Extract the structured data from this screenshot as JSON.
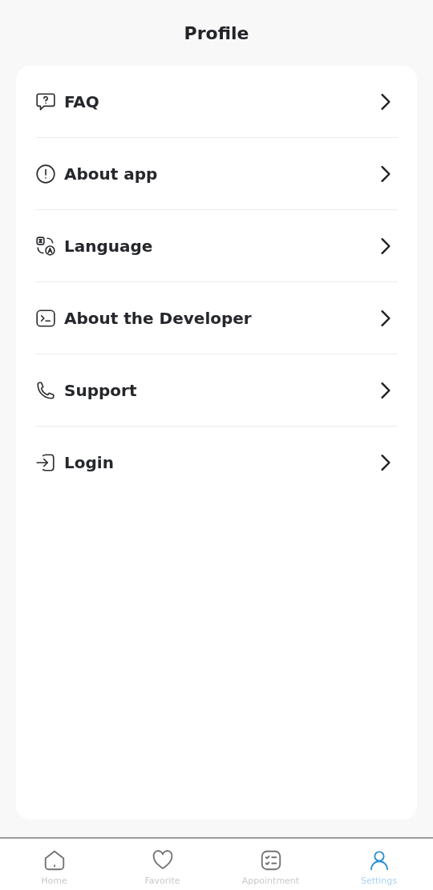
{
  "header": {
    "title": "Profile"
  },
  "menu": [
    {
      "label": "FAQ"
    },
    {
      "label": "About app"
    },
    {
      "label": "Language"
    },
    {
      "label": "About the Developer"
    },
    {
      "label": "Support"
    },
    {
      "label": "Login"
    }
  ],
  "bottom_nav": [
    {
      "label": "Home",
      "selected": false
    },
    {
      "label": "Favorite",
      "selected": false
    },
    {
      "label": "Appointment",
      "selected": false
    },
    {
      "label": "Settings",
      "selected": true
    }
  ]
}
